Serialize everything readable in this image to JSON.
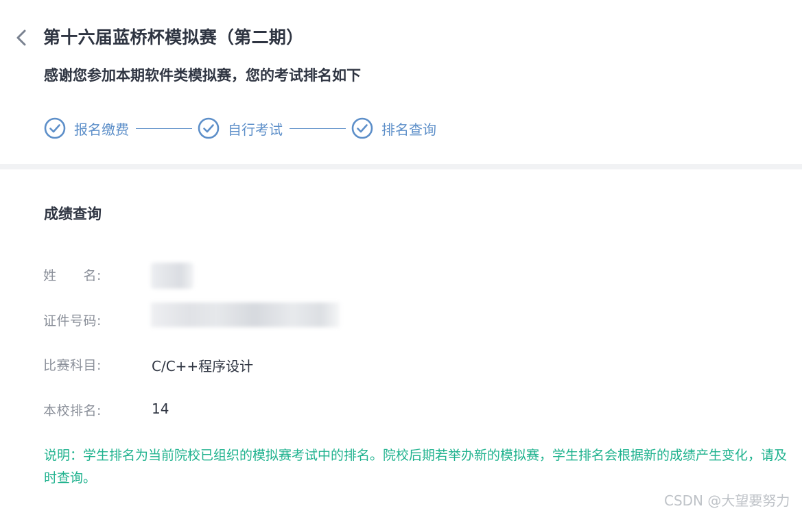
{
  "header": {
    "title": "第十六届蓝桥杯模拟赛（第二期）",
    "subtitle": "感谢您参加本期软件类模拟赛，您的考试排名如下"
  },
  "steps": [
    {
      "label": "报名缴费",
      "icon": "check-circle-icon"
    },
    {
      "label": "自行考试",
      "icon": "check-circle-icon"
    },
    {
      "label": "排名查询",
      "icon": "check-circle-icon"
    }
  ],
  "colors": {
    "accent": "#5d8fc9",
    "note": "#1fb28e",
    "title": "#2f3542",
    "label": "#8a8f99"
  },
  "results": {
    "section_title": "成绩查询",
    "fields": [
      {
        "label": "姓　　名:",
        "value": ""
      },
      {
        "label": "证件号码:",
        "value": ""
      },
      {
        "label": "比赛科目:",
        "value": "C/C++程序设计"
      },
      {
        "label": "本校排名:",
        "value": "14"
      }
    ]
  },
  "note": "说明：学生排名为当前院校已组织的模拟赛考试中的排名。院校后期若举办新的模拟赛，学生排名会根据新的成绩产生变化，请及时查询。",
  "watermark": "CSDN @大望要努力"
}
